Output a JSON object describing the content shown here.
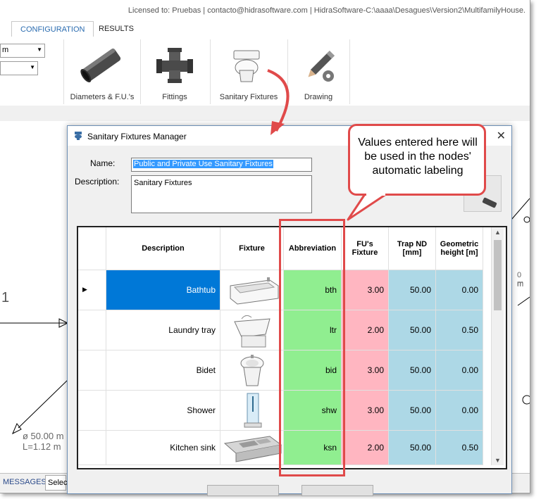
{
  "app": {
    "licensed_text": "Licensed to: Pruebas | contacto@hidrasoftware.com | HidraSoftware-C:\\aaaa\\Desagues\\Version2\\MultifamilyHouse.",
    "tabs": [
      {
        "label": "CONFIGURATION"
      },
      {
        "label": "RESULTS"
      }
    ],
    "combo_top_value": "m",
    "ribbon_groups": [
      {
        "label": "Diameters & F.U.'s",
        "icon": "pipe-icon"
      },
      {
        "label": "Fittings",
        "icon": "fitting-icon"
      },
      {
        "label": "Sanitary Fixtures",
        "icon": "toilet-icon"
      },
      {
        "label": "Drawing",
        "icon": "pencil-gear-icon"
      }
    ],
    "canvas_texts": {
      "node": "1",
      "pipe_diameter": "ø 50.00 m",
      "pipe_length": "L=1.12 m",
      "right_partial_1": "0 m",
      "right_partial_2": "m"
    },
    "status": {
      "messages": "MESSAGES",
      "select": "Selec"
    }
  },
  "dialog": {
    "title": "Sanitary Fixtures Manager",
    "name_label": "Name:",
    "name_value": "Public and Private Use Sanitary Fixtures",
    "description_label": "Description:",
    "description_value": "Sanitary Fixtures"
  },
  "grid": {
    "headers": {
      "description": "Description",
      "fixture": "Fixture",
      "abbreviation": "Abbreviation",
      "fus": "FU's Fixture",
      "trap": "Trap ND [mm]",
      "height": "Geometric height [m]"
    },
    "rows": [
      {
        "description": "Bathtub",
        "abbreviation": "bth",
        "fus": "3.00",
        "trap": "50.00",
        "height": "0.00",
        "icon": "bathtub-icon"
      },
      {
        "description": "Laundry tray",
        "abbreviation": "ltr",
        "fus": "2.00",
        "trap": "50.00",
        "height": "0.50",
        "icon": "laundry-tray-icon"
      },
      {
        "description": "Bidet",
        "abbreviation": "bid",
        "fus": "3.00",
        "trap": "50.00",
        "height": "0.00",
        "icon": "bidet-icon"
      },
      {
        "description": "Shower",
        "abbreviation": "shw",
        "fus": "3.00",
        "trap": "50.00",
        "height": "0.00",
        "icon": "shower-icon"
      },
      {
        "description": "Kitchen sink",
        "abbreviation": "ksn",
        "fus": "2.00",
        "trap": "50.00",
        "height": "0.50",
        "icon": "kitchen-sink-icon"
      }
    ]
  },
  "callout": {
    "text": "Values entered here will be used in the nodes' automatic labeling"
  },
  "colors": {
    "abbreviation_fill": "#90ee90",
    "fus_fill": "#ffb6c1",
    "trap_fill": "#add8e6",
    "height_fill": "#add8e6",
    "selected_row": "#0078d7",
    "callout_border": "#e04a4a"
  }
}
